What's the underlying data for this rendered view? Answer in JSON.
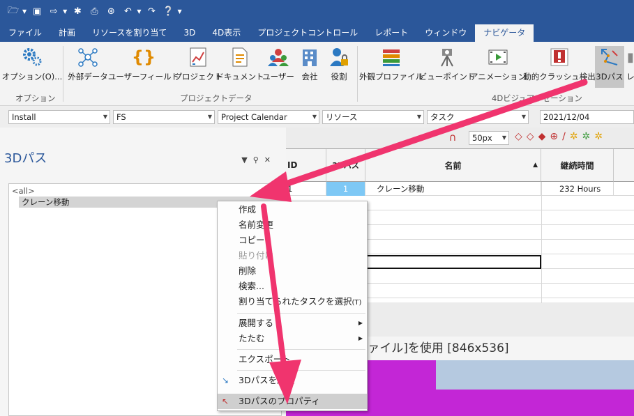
{
  "qat": {
    "icons": [
      "folder-open-icon",
      "save-icon",
      "exit-icon",
      "settings-icon",
      "print-icon",
      "network-icon",
      "undo-icon",
      "redo-icon",
      "help-icon"
    ]
  },
  "menu": {
    "tabs": [
      {
        "label": "ファイル"
      },
      {
        "label": "計画"
      },
      {
        "label": "リソースを割り当て"
      },
      {
        "label": "3D"
      },
      {
        "label": "4D表示"
      },
      {
        "label": "プロジェクトコントロール"
      },
      {
        "label": "レポート"
      },
      {
        "label": "ウィンドウ"
      },
      {
        "label": "ナビゲータ"
      }
    ],
    "active": "ナビゲータ"
  },
  "ribbon": {
    "options": "オプション(O)...",
    "external_data": "外部データ",
    "user_field": "ユーザーフィールド",
    "project": "プロジェクト",
    "document": "ドキュメント",
    "user": "ユーザー",
    "company": "会社",
    "role": "役割",
    "appearance_profile": "外観プロファイル",
    "viewpoint": "ビューポイント",
    "animation": "アニメーション",
    "clash": "動的クラッシュ検出",
    "path3d": "3Dパス",
    "path_next": "レ",
    "group_options": "オプション",
    "group_project": "プロジェクトデータ",
    "group_visual": "4Dビジュアリゼーション"
  },
  "toolbar": {
    "combo1": "Install",
    "combo2": "FS",
    "combo3": "Project Calendar",
    "combo4": "リソース",
    "combo5": "タスク",
    "date": "2021/12/04",
    "zoom": "50px"
  },
  "panel": {
    "title": "3Dパス",
    "root": "<all>",
    "item": "クレーン移動"
  },
  "grid": {
    "headers": {
      "id": "ID",
      "path": "3Dパス",
      "name": "名前",
      "duration": "継続時間"
    },
    "row1": {
      "id": "1",
      "path": "1",
      "name": "クレーン移動",
      "duration": "232 Hours"
    }
  },
  "view": {
    "title": "]色[外観プロファイル]を使用  [846x536]"
  },
  "context_menu": {
    "create": "作成",
    "rename": "名前変更",
    "copy": "コピー",
    "paste": "貼り付け",
    "delete": "削除",
    "search": "検索...",
    "select_tasks": "割り当てられたタスクを選択",
    "select_tasks_key": "(T)",
    "expand": "展開する",
    "collapse": "たたむ",
    "export": "エクスポート",
    "edit_path": "3Dパスを編集",
    "properties": "3Dパスのプロパティ"
  },
  "colors": {
    "accent": "#2b579a",
    "arrow": "#f0346e",
    "view_magenta": "#c326d6",
    "view_blue": "#b5c9e0",
    "path_cell": "#7ec8f5"
  }
}
